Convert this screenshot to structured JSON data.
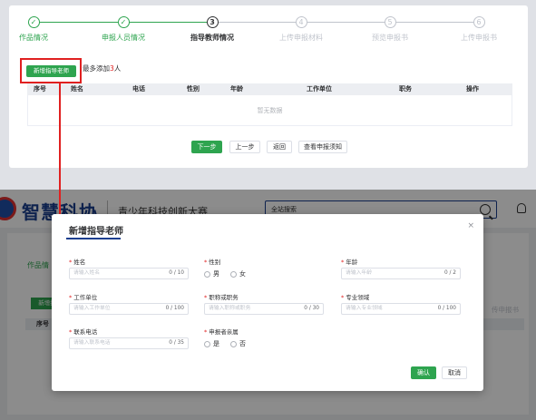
{
  "top": {
    "steps": [
      {
        "num": "✓",
        "label": "作品情况",
        "state": "done"
      },
      {
        "num": "✓",
        "label": "申报人员情况",
        "state": "done"
      },
      {
        "num": "3",
        "label": "指导教师情况",
        "state": "active"
      },
      {
        "num": "4",
        "label": "上传申报材料",
        "state": "todo"
      },
      {
        "num": "5",
        "label": "预览申报书",
        "state": "todo"
      },
      {
        "num": "6",
        "label": "上传申报书",
        "state": "todo"
      }
    ],
    "add_button": "新增指导老师",
    "limit_prefix": "最多添加",
    "limit_num": "3",
    "limit_suffix": "人",
    "columns": [
      "序号",
      "姓名",
      "电话",
      "性别",
      "年龄",
      "工作单位",
      "职务",
      "操作"
    ],
    "empty_text": "暂无数据",
    "buttons": {
      "next": "下一步",
      "prev": "上一步",
      "back": "返回",
      "notice": "查看申报须知"
    }
  },
  "screen2": {
    "brand": "智慧科协",
    "subtitle": "青少年科技创新大赛",
    "search_scope": "全站搜索",
    "ghost_step": "作品情",
    "ghost_btn": "新增指",
    "ghost_th": "序号",
    "ghost_right": "传申报书"
  },
  "modal": {
    "title": "新增指导老师",
    "close": "×",
    "fields": {
      "name": {
        "label": "姓名",
        "placeholder": "请输入姓名",
        "count": "0 / 10"
      },
      "gender": {
        "label": "性别",
        "options": [
          "男",
          "女"
        ]
      },
      "age": {
        "label": "年龄",
        "placeholder": "请输入年龄",
        "count": "0 / 2"
      },
      "workplace": {
        "label": "工作单位",
        "placeholder": "请输入工作单位",
        "count": "0 / 100"
      },
      "position": {
        "label": "职称或职务",
        "placeholder": "请输入职称或职务",
        "count": "0 / 30"
      },
      "field_area": {
        "label": "专业领域",
        "placeholder": "请输入专业领域",
        "count": "0 / 100"
      },
      "phone": {
        "label": "联系电话",
        "placeholder": "请输入联系电话",
        "count": "0 / 35"
      },
      "relative": {
        "label": "申报者亲属",
        "options": [
          "是",
          "否"
        ]
      }
    },
    "confirm": "确认",
    "cancel": "取消"
  },
  "colors": {
    "green": "#2ea44f",
    "red": "#e02020",
    "brand_blue": "#1a3f8f"
  }
}
